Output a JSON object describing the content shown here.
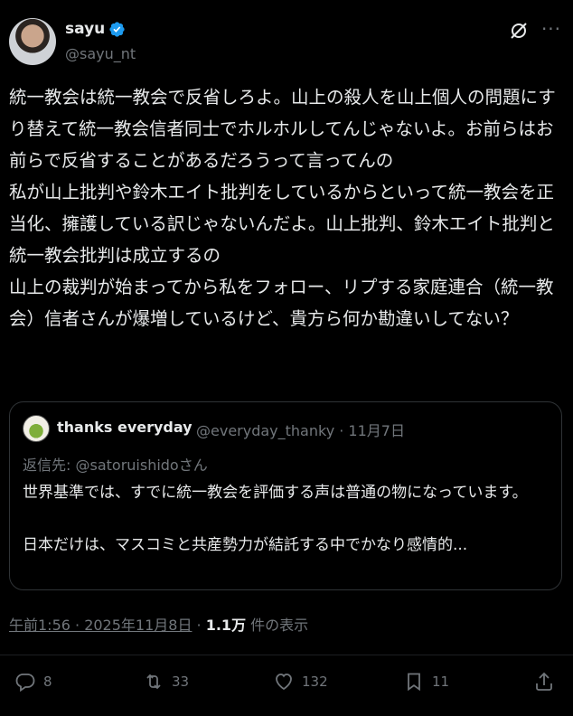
{
  "author": {
    "name": "sayu",
    "handle": "@sayu_nt"
  },
  "icons": {
    "verified": "verified-badge-icon",
    "grok": "grok-icon",
    "more": "more-icon"
  },
  "tweet": {
    "text": "統一教会は統一教会で反省しろよ。山上の殺人を山上個人の問題にすり替えて統一教会信者同士でホルホルしてんじゃないよ。お前らはお前らで反省することがあるだろうって言ってんの\n私が山上批判や鈴木エイト批判をしているからといって統一教会を正当化、擁護している訳じゃないんだよ。山上批判、鈴木エイト批判と統一教会批判は成立するの\n山上の裁判が始まってから私をフォロー、リプする家庭連合（統一教会）信者さんが爆増しているけど、貴方ら何か勘違いしてない？"
  },
  "quote": {
    "name": "thanks everyday",
    "handle": "@everyday_thanky",
    "date": "11月7日",
    "reply_prefix": "返信先: ",
    "reply_to": "@satoruishido",
    "reply_suffix": "さん",
    "text": "世界基準では、すでに統一教会を評価する声は普通の物になっています。\n\n日本だけは、マスコミと共産勢力が結託する中でかなり感情的..."
  },
  "meta": {
    "time": "午前1:56 · 2025年11月8日",
    "separator": " · ",
    "views_count": "1.1万",
    "views_label": " 件の表示"
  },
  "actions": {
    "replies": "8",
    "retweets": "33",
    "likes": "132",
    "bookmarks": "11"
  },
  "colors": {
    "background": "#000000",
    "text": "#e7e9ea",
    "secondary": "#71767b",
    "verified": "#1d9bf0",
    "border": "#2f3336"
  }
}
